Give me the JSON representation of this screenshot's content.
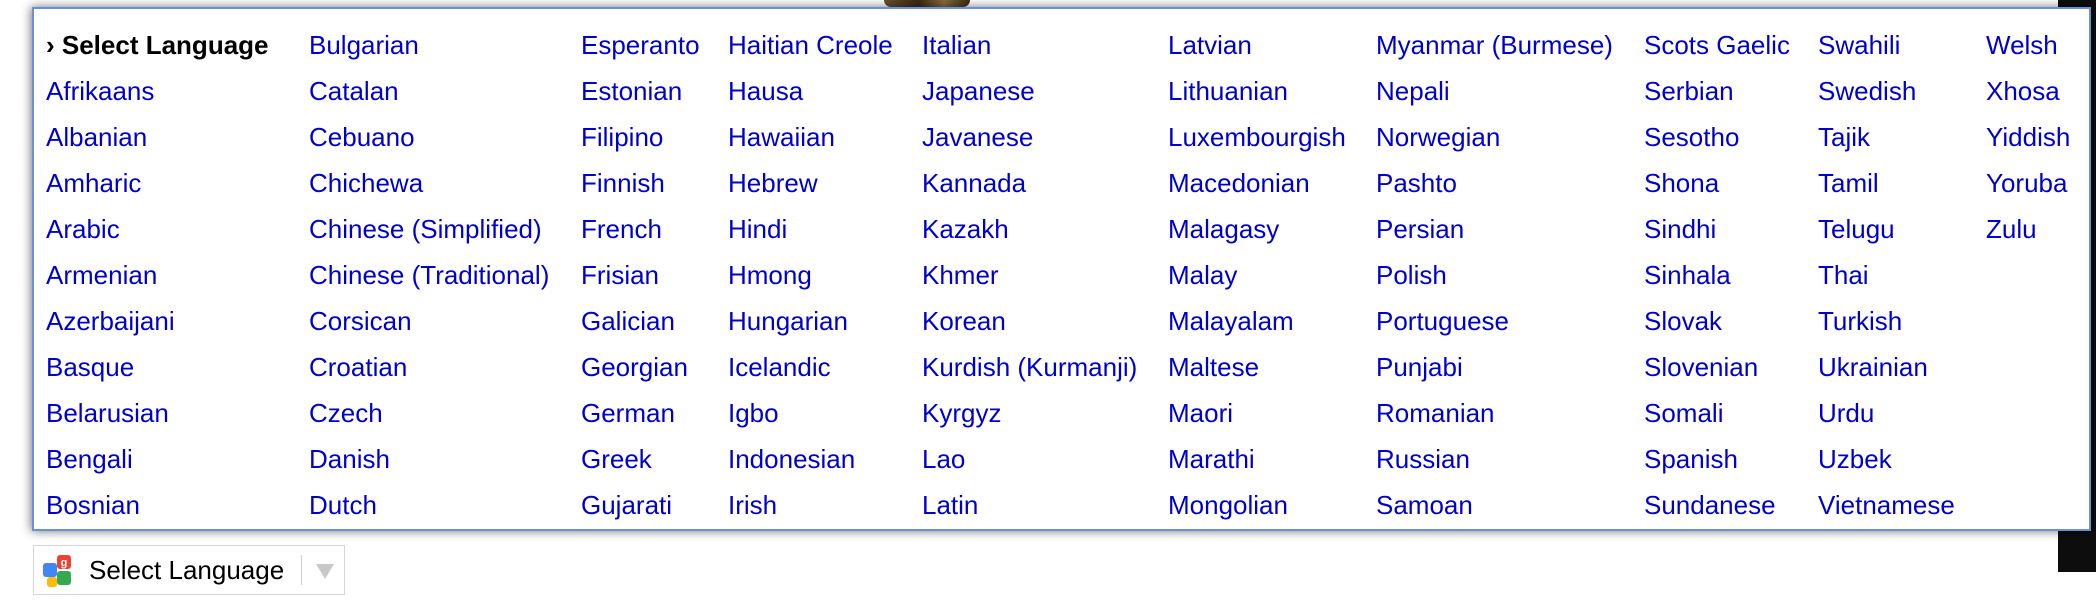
{
  "menu": {
    "columns": [
      [
        "› Select Language",
        "Afrikaans",
        "Albanian",
        "Amharic",
        "Arabic",
        "Armenian",
        "Azerbaijani",
        "Basque",
        "Belarusian",
        "Bengali",
        "Bosnian"
      ],
      [
        "Bulgarian",
        "Catalan",
        "Cebuano",
        "Chichewa",
        "Chinese (Simplified)",
        "Chinese (Traditional)",
        "Corsican",
        "Croatian",
        "Czech",
        "Danish",
        "Dutch"
      ],
      [
        "Esperanto",
        "Estonian",
        "Filipino",
        "Finnish",
        "French",
        "Frisian",
        "Galician",
        "Georgian",
        "German",
        "Greek",
        "Gujarati"
      ],
      [
        "Haitian Creole",
        "Hausa",
        "Hawaiian",
        "Hebrew",
        "Hindi",
        "Hmong",
        "Hungarian",
        "Icelandic",
        "Igbo",
        "Indonesian",
        "Irish"
      ],
      [
        "Italian",
        "Japanese",
        "Javanese",
        "Kannada",
        "Kazakh",
        "Khmer",
        "Korean",
        "Kurdish (Kurmanji)",
        "Kyrgyz",
        "Lao",
        "Latin"
      ],
      [
        "Latvian",
        "Lithuanian",
        "Luxembourgish",
        "Macedonian",
        "Malagasy",
        "Malay",
        "Malayalam",
        "Maltese",
        "Maori",
        "Marathi",
        "Mongolian"
      ],
      [
        "Myanmar (Burmese)",
        "Nepali",
        "Norwegian",
        "Pashto",
        "Persian",
        "Polish",
        "Portuguese",
        "Punjabi",
        "Romanian",
        "Russian",
        "Samoan"
      ],
      [
        "Scots Gaelic",
        "Serbian",
        "Sesotho",
        "Shona",
        "Sindhi",
        "Sinhala",
        "Slovak",
        "Slovenian",
        "Somali",
        "Spanish",
        "Sundanese"
      ],
      [
        "Swahili",
        "Swedish",
        "Tajik",
        "Tamil",
        "Telugu",
        "Thai",
        "Turkish",
        "Ukrainian",
        "Urdu",
        "Uzbek",
        "Vietnamese"
      ],
      [
        "Welsh",
        "Xhosa",
        "Yiddish",
        "Yoruba",
        "Zulu"
      ]
    ]
  },
  "widget": {
    "label": "Select Language",
    "icon": "google-translate-icon",
    "arrow_icon": "dropdown-arrow-icon"
  },
  "colors": {
    "link": "#0000cc",
    "border": "#6b90da"
  }
}
